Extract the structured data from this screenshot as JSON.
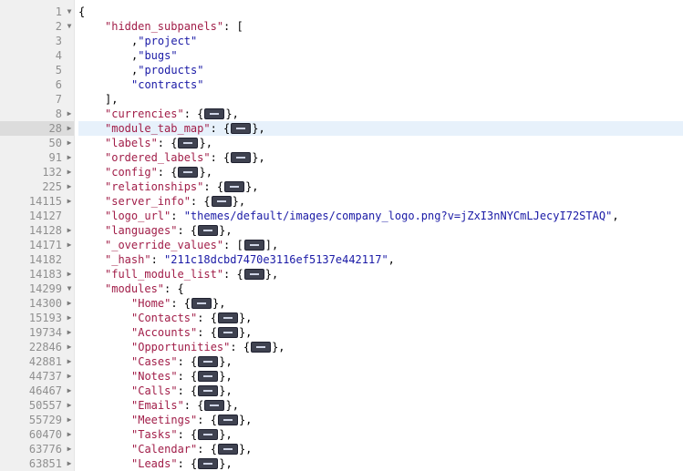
{
  "editor": {
    "lines": [
      {
        "n": "1",
        "fold": "down",
        "indent": 0,
        "text": "{"
      },
      {
        "n": "2",
        "fold": "down",
        "indent": 1,
        "key": "\"hidden_subpanels\"",
        "after": ": ["
      },
      {
        "n": "3",
        "indent": 2,
        "str": "\"project\"",
        "after": ","
      },
      {
        "n": "4",
        "indent": 2,
        "str": "\"bugs\"",
        "after": ","
      },
      {
        "n": "5",
        "indent": 2,
        "str": "\"products\"",
        "after": ","
      },
      {
        "n": "6",
        "indent": 2,
        "str": "\"contracts\""
      },
      {
        "n": "7",
        "indent": 1,
        "text": "],"
      },
      {
        "n": "8",
        "fold": "right",
        "indent": 1,
        "key": "\"currencies\"",
        "after": ": {",
        "collapsed": true,
        "close": "},"
      },
      {
        "n": "28",
        "fold": "right",
        "indent": 1,
        "key": "\"module_tab_map\"",
        "after": ": {",
        "collapsed": true,
        "close": "},",
        "active": true
      },
      {
        "n": "50",
        "fold": "right",
        "indent": 1,
        "key": "\"labels\"",
        "after": ": {",
        "collapsed": true,
        "close": "},"
      },
      {
        "n": "91",
        "fold": "right",
        "indent": 1,
        "key": "\"ordered_labels\"",
        "after": ": {",
        "collapsed": true,
        "close": "},"
      },
      {
        "n": "132",
        "fold": "right",
        "indent": 1,
        "key": "\"config\"",
        "after": ": {",
        "collapsed": true,
        "close": "},"
      },
      {
        "n": "225",
        "fold": "right",
        "indent": 1,
        "key": "\"relationships\"",
        "after": ": {",
        "collapsed": true,
        "close": "},"
      },
      {
        "n": "14115",
        "fold": "right",
        "indent": 1,
        "key": "\"server_info\"",
        "after": ": {",
        "collapsed": true,
        "close": "},"
      },
      {
        "n": "14127",
        "indent": 1,
        "key": "\"logo_url\"",
        "after": ": ",
        "str": "\"themes/default/images/company_logo.png?v=jZxI3nNYCmLJecyI72STAQ\"",
        "tail": ","
      },
      {
        "n": "14128",
        "fold": "right",
        "indent": 1,
        "key": "\"languages\"",
        "after": ": {",
        "collapsed": true,
        "close": "},"
      },
      {
        "n": "14171",
        "fold": "right",
        "indent": 1,
        "key": "\"_override_values\"",
        "after": ": [",
        "collapsed": true,
        "close": "],"
      },
      {
        "n": "14182",
        "indent": 1,
        "key": "\"_hash\"",
        "after": ": ",
        "str": "\"211c18dcbd7470e3116ef5137e442117\"",
        "tail": ","
      },
      {
        "n": "14183",
        "fold": "right",
        "indent": 1,
        "key": "\"full_module_list\"",
        "after": ": {",
        "collapsed": true,
        "close": "},"
      },
      {
        "n": "14299",
        "fold": "down",
        "indent": 1,
        "key": "\"modules\"",
        "after": ": {"
      },
      {
        "n": "14300",
        "fold": "right",
        "indent": 2,
        "key": "\"Home\"",
        "after": ": {",
        "collapsed": true,
        "close": "},"
      },
      {
        "n": "15193",
        "fold": "right",
        "indent": 2,
        "key": "\"Contacts\"",
        "after": ": {",
        "collapsed": true,
        "close": "},"
      },
      {
        "n": "19734",
        "fold": "right",
        "indent": 2,
        "key": "\"Accounts\"",
        "after": ": {",
        "collapsed": true,
        "close": "},"
      },
      {
        "n": "22846",
        "fold": "right",
        "indent": 2,
        "key": "\"Opportunities\"",
        "after": ": {",
        "collapsed": true,
        "close": "},"
      },
      {
        "n": "42881",
        "fold": "right",
        "indent": 2,
        "key": "\"Cases\"",
        "after": ": {",
        "collapsed": true,
        "close": "},"
      },
      {
        "n": "44737",
        "fold": "right",
        "indent": 2,
        "key": "\"Notes\"",
        "after": ": {",
        "collapsed": true,
        "close": "},"
      },
      {
        "n": "46467",
        "fold": "right",
        "indent": 2,
        "key": "\"Calls\"",
        "after": ": {",
        "collapsed": true,
        "close": "},"
      },
      {
        "n": "50557",
        "fold": "right",
        "indent": 2,
        "key": "\"Emails\"",
        "after": ": {",
        "collapsed": true,
        "close": "},"
      },
      {
        "n": "55729",
        "fold": "right",
        "indent": 2,
        "key": "\"Meetings\"",
        "after": ": {",
        "collapsed": true,
        "close": "},"
      },
      {
        "n": "60470",
        "fold": "right",
        "indent": 2,
        "key": "\"Tasks\"",
        "after": ": {",
        "collapsed": true,
        "close": "},"
      },
      {
        "n": "63776",
        "fold": "right",
        "indent": 2,
        "key": "\"Calendar\"",
        "after": ": {",
        "collapsed": true,
        "close": "},"
      },
      {
        "n": "63851",
        "fold": "right",
        "indent": 2,
        "key": "\"Leads\"",
        "after": ": {",
        "collapsed": true,
        "close": "},"
      }
    ]
  },
  "icons": {
    "fold_down": "triangle-down-icon",
    "fold_right": "triangle-right-icon",
    "collapsed": "ellipsis-icon"
  },
  "colors": {
    "key": "#a11d48",
    "string": "#1a1aa6",
    "active_line": "#e7f1fb",
    "gutter": "#f0f0f0"
  }
}
